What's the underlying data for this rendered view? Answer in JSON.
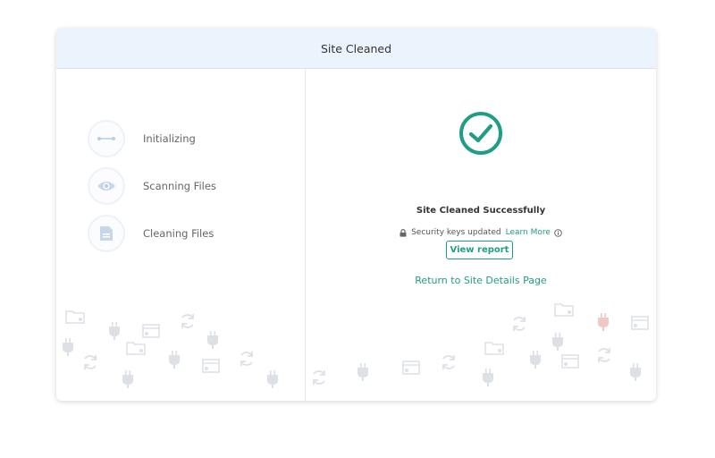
{
  "card": {
    "title": "Site Cleaned"
  },
  "steps": [
    {
      "label": "Initializing",
      "icon": "arrows-icon"
    },
    {
      "label": "Scanning Files",
      "icon": "eye-icon"
    },
    {
      "label": "Cleaning Files",
      "icon": "file-icon"
    }
  ],
  "result": {
    "headline": "Site Cleaned Successfully",
    "security_text": "Security keys updated",
    "learn_more": "Learn More",
    "view_report": "View report",
    "return_link": "Return to Site Details Page"
  },
  "colors": {
    "accent": "#1f9d85",
    "header_bg": "#ebf3fd",
    "step_icon": "#b8cce4",
    "bg_icon": "#dde1e6"
  }
}
